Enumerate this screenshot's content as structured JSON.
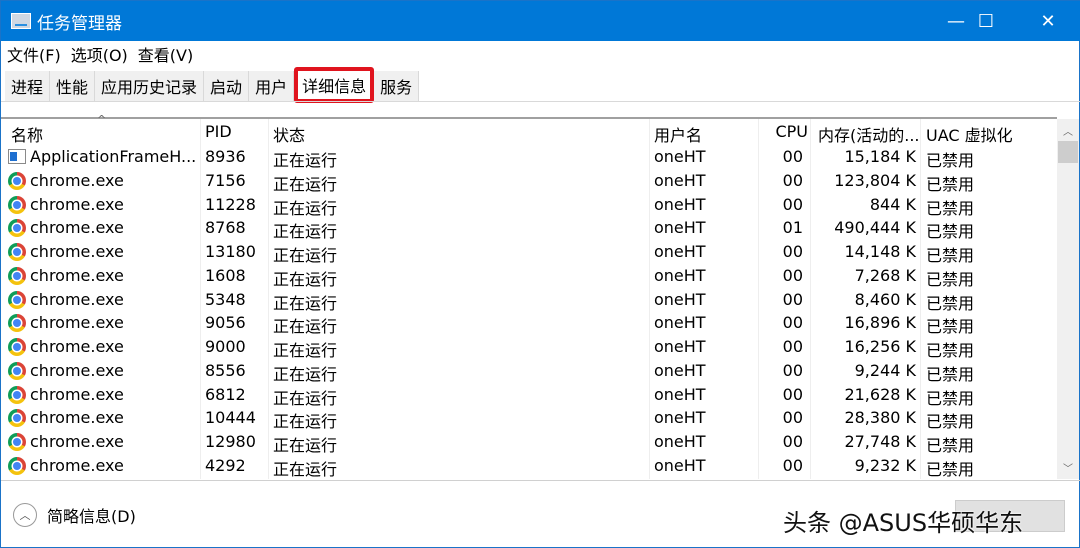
{
  "window": {
    "title": "任务管理器",
    "minimize": "—",
    "maximize": "☐",
    "close": "✕"
  },
  "menu": [
    "文件(F)",
    "选项(O)",
    "查看(V)"
  ],
  "tabs": [
    "进程",
    "性能",
    "应用历史记录",
    "启动",
    "用户",
    "详细信息",
    "服务"
  ],
  "active_tab": "详细信息",
  "columns": [
    "名称",
    "PID",
    "状态",
    "用户名",
    "CPU",
    "内存(活动的...",
    "UAC 虚拟化"
  ],
  "rows": [
    {
      "name": "ApplicationFrameH...",
      "pid": "8936",
      "status": "正在运行",
      "user": "oneHT",
      "cpu": "00",
      "mem": "15,184 K",
      "uac": "已禁用",
      "icon": "app-frame-icon"
    },
    {
      "name": "chrome.exe",
      "pid": "7156",
      "status": "正在运行",
      "user": "oneHT",
      "cpu": "00",
      "mem": "123,804 K",
      "uac": "已禁用",
      "icon": "chrome-icon"
    },
    {
      "name": "chrome.exe",
      "pid": "11228",
      "status": "正在运行",
      "user": "oneHT",
      "cpu": "00",
      "mem": "844 K",
      "uac": "已禁用",
      "icon": "chrome-icon"
    },
    {
      "name": "chrome.exe",
      "pid": "8768",
      "status": "正在运行",
      "user": "oneHT",
      "cpu": "01",
      "mem": "490,444 K",
      "uac": "已禁用",
      "icon": "chrome-icon"
    },
    {
      "name": "chrome.exe",
      "pid": "13180",
      "status": "正在运行",
      "user": "oneHT",
      "cpu": "00",
      "mem": "14,148 K",
      "uac": "已禁用",
      "icon": "chrome-icon"
    },
    {
      "name": "chrome.exe",
      "pid": "1608",
      "status": "正在运行",
      "user": "oneHT",
      "cpu": "00",
      "mem": "7,268 K",
      "uac": "已禁用",
      "icon": "chrome-icon"
    },
    {
      "name": "chrome.exe",
      "pid": "5348",
      "status": "正在运行",
      "user": "oneHT",
      "cpu": "00",
      "mem": "8,460 K",
      "uac": "已禁用",
      "icon": "chrome-icon"
    },
    {
      "name": "chrome.exe",
      "pid": "9056",
      "status": "正在运行",
      "user": "oneHT",
      "cpu": "00",
      "mem": "16,896 K",
      "uac": "已禁用",
      "icon": "chrome-icon"
    },
    {
      "name": "chrome.exe",
      "pid": "9000",
      "status": "正在运行",
      "user": "oneHT",
      "cpu": "00",
      "mem": "16,256 K",
      "uac": "已禁用",
      "icon": "chrome-icon"
    },
    {
      "name": "chrome.exe",
      "pid": "8556",
      "status": "正在运行",
      "user": "oneHT",
      "cpu": "00",
      "mem": "9,244 K",
      "uac": "已禁用",
      "icon": "chrome-icon"
    },
    {
      "name": "chrome.exe",
      "pid": "6812",
      "status": "正在运行",
      "user": "oneHT",
      "cpu": "00",
      "mem": "21,628 K",
      "uac": "已禁用",
      "icon": "chrome-icon"
    },
    {
      "name": "chrome.exe",
      "pid": "10444",
      "status": "正在运行",
      "user": "oneHT",
      "cpu": "00",
      "mem": "28,380 K",
      "uac": "已禁用",
      "icon": "chrome-icon"
    },
    {
      "name": "chrome.exe",
      "pid": "12980",
      "status": "正在运行",
      "user": "oneHT",
      "cpu": "00",
      "mem": "27,748 K",
      "uac": "已禁用",
      "icon": "chrome-icon"
    },
    {
      "name": "chrome.exe",
      "pid": "4292",
      "status": "正在运行",
      "user": "oneHT",
      "cpu": "00",
      "mem": "9,232 K",
      "uac": "已禁用",
      "icon": "chrome-icon"
    }
  ],
  "footer": {
    "less_details": "简略信息(D)"
  },
  "watermark": "头条 @ASUS华硕华东"
}
